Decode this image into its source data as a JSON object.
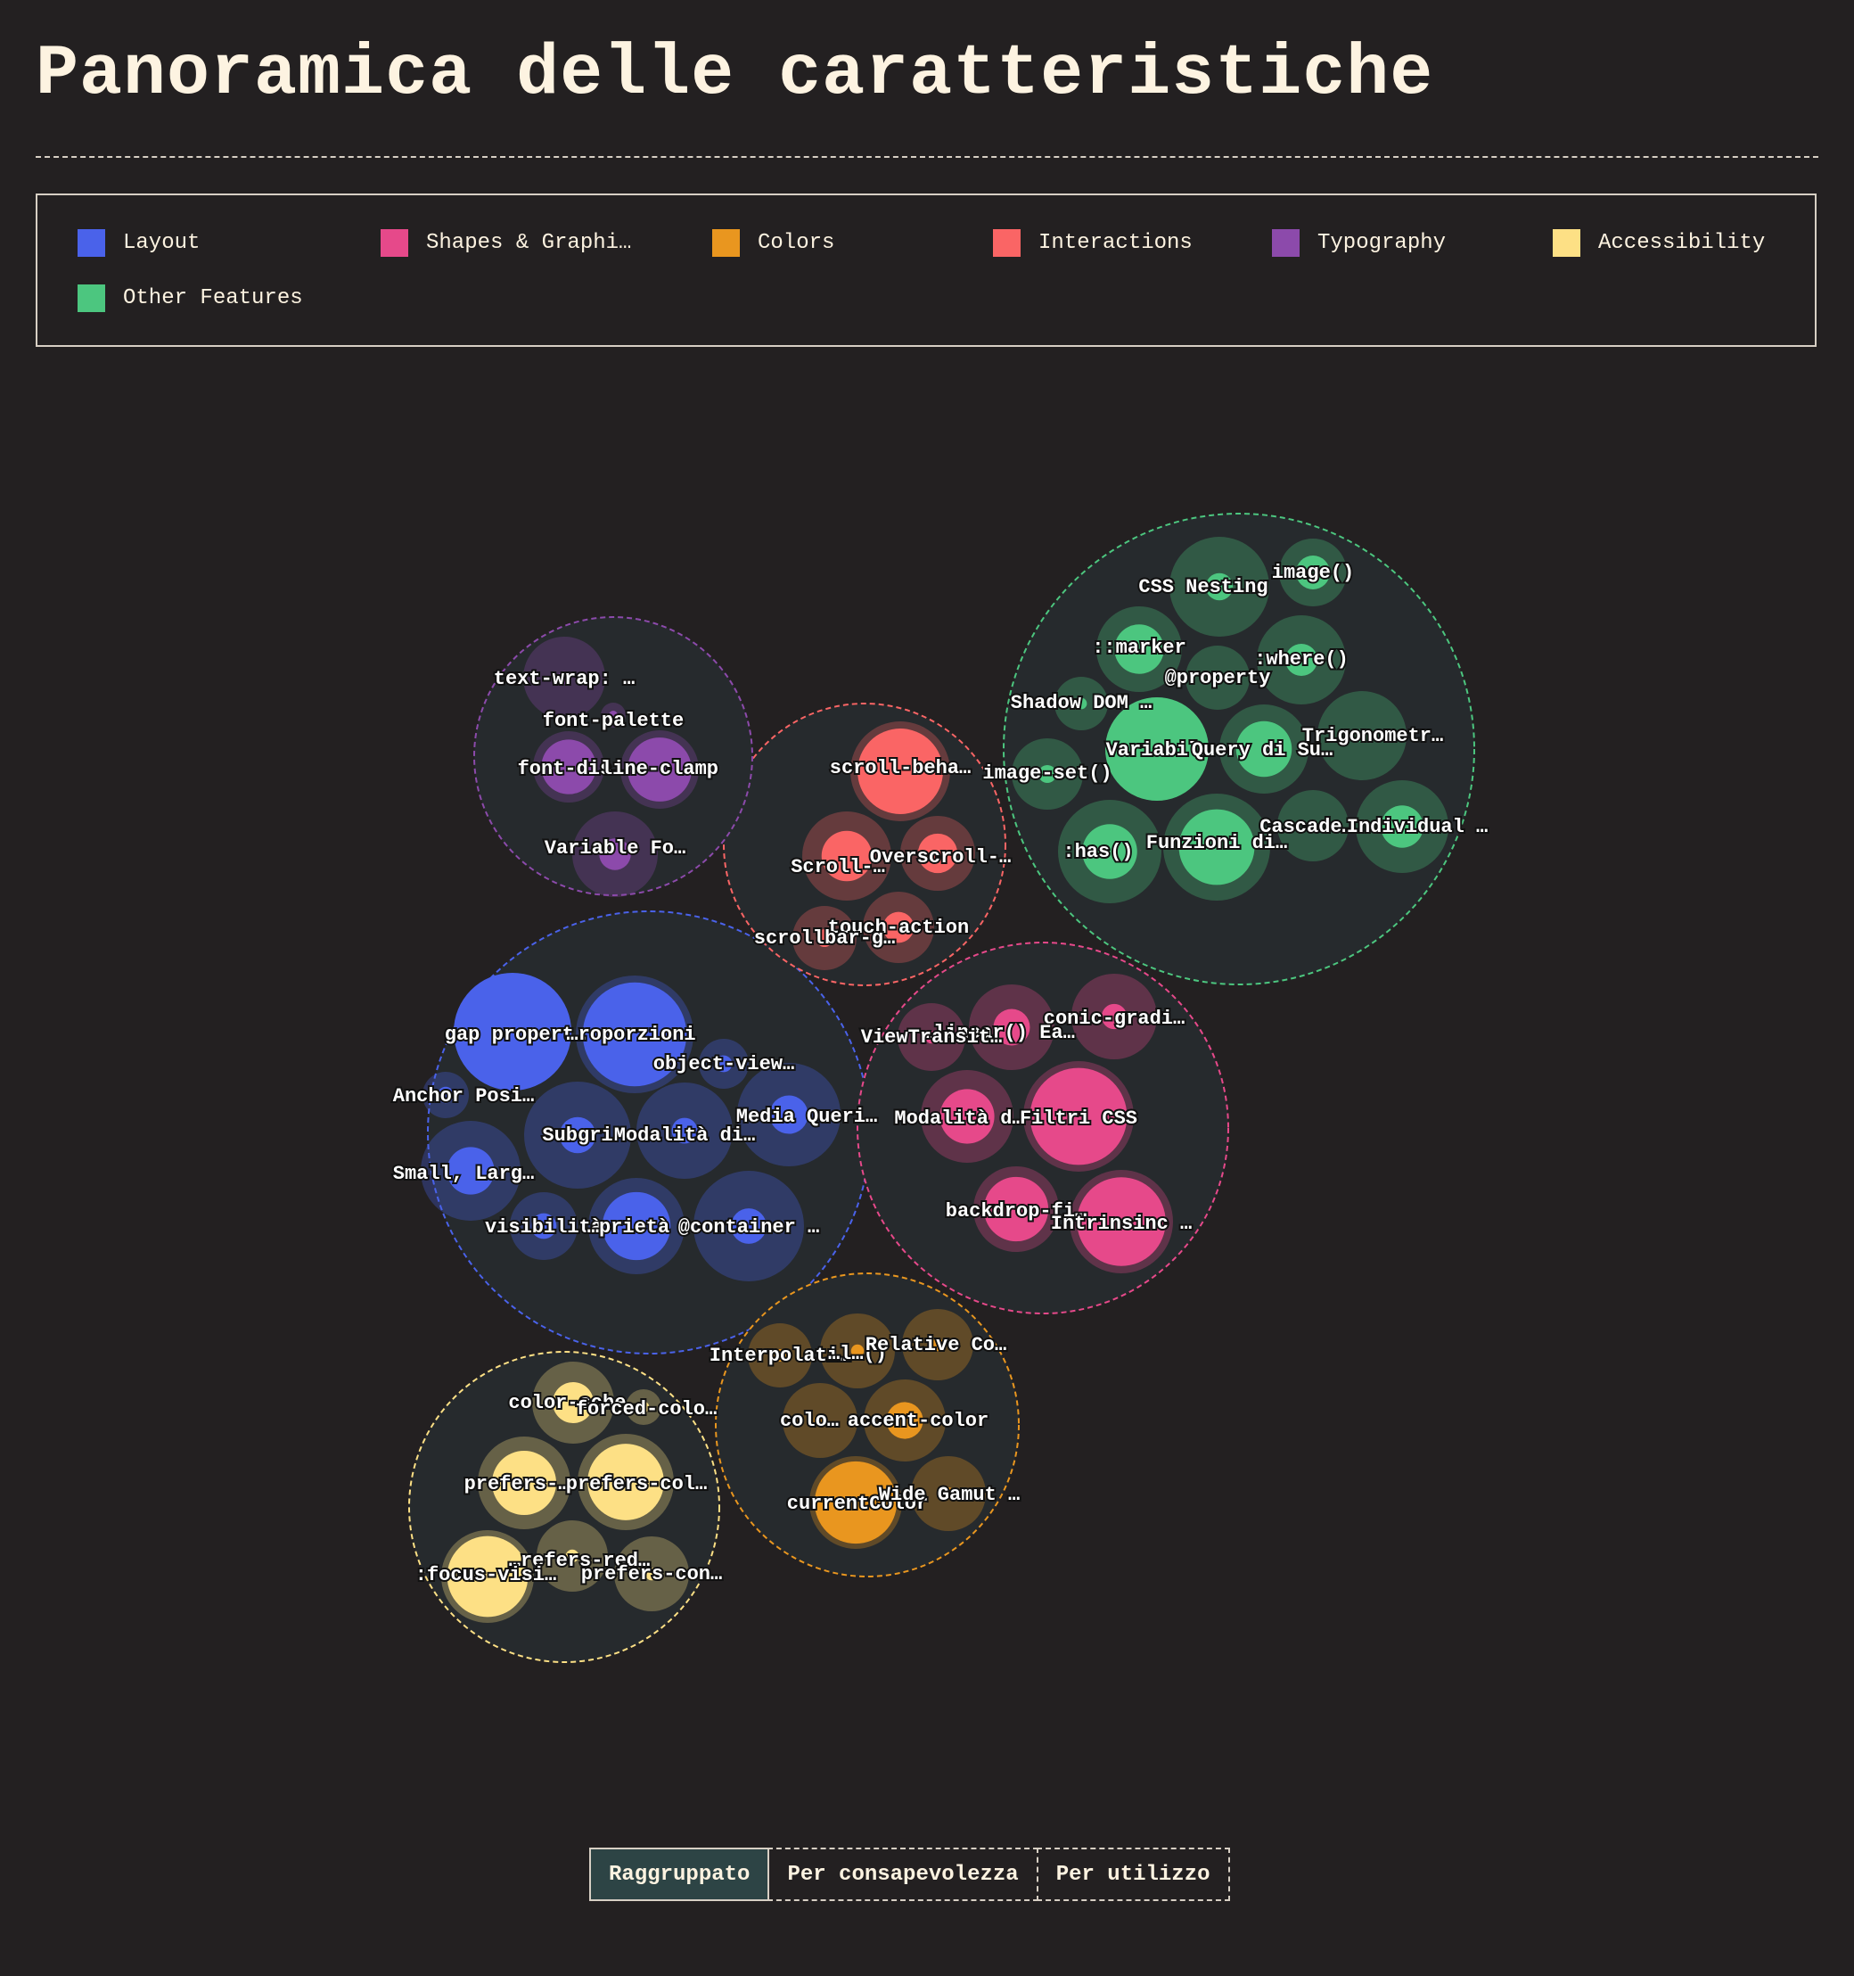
{
  "title": "Panoramica delle caratteristiche",
  "legend": [
    {
      "label": "Layout",
      "color": "#4a62ea"
    },
    {
      "label": "Shapes & Graphi…",
      "color": "#e6498a"
    },
    {
      "label": "Colors",
      "color": "#e9961f"
    },
    {
      "label": "Interactions",
      "color": "#fa6565"
    },
    {
      "label": "Typography",
      "color": "#8c4aab"
    },
    {
      "label": "Accessibility",
      "color": "#fde085"
    },
    {
      "label": "Other Features",
      "color": "#4cc67f"
    }
  ],
  "toggle": [
    {
      "label": "Raggruppato",
      "active": true
    },
    {
      "label": "Per consapevolezza",
      "active": false
    },
    {
      "label": "Per utilizzo",
      "active": false
    }
  ],
  "chart_data": {
    "type": "packed-bubble",
    "note_on_values": "size = relative awareness (outer), usage (inner), estimated 0-100",
    "groups": [
      {
        "name": "Layout",
        "color": "#4a62ea",
        "items": [
          {
            "label": "gap propert…",
            "outer": 90,
            "inner": 90
          },
          {
            "label": "…roporzioni",
            "outer": 90,
            "inner": 70
          },
          {
            "label": "object-view…",
            "outer": 18,
            "inner": 2
          },
          {
            "label": "Anchor Posi…",
            "outer": 16,
            "inner": 2
          },
          {
            "label": "Media Queri…",
            "outer": 58,
            "inner": 8
          },
          {
            "label": "Subgri",
            "outer": 70,
            "inner": 8
          },
          {
            "label": "Modalità di…",
            "outer": 56,
            "inner": 4
          },
          {
            "label": "Small, Larg…",
            "outer": 62,
            "inner": 14
          },
          {
            "label": "visibilità",
            "outer": 28,
            "inner": 4
          },
          {
            "label": "…prietà",
            "outer": 56,
            "inner": 28
          },
          {
            "label": "@container …",
            "outer": 78,
            "inner": 8
          }
        ]
      },
      {
        "name": "Shapes & Graphics",
        "color": "#e6498a",
        "items": [
          {
            "label": "conic-gradi…",
            "outer": 46,
            "inner": 4
          },
          {
            "label": "…linear() Ea…",
            "outer": 44,
            "inner": 8
          },
          {
            "label": "ViewTransit…",
            "outer": 28,
            "inner": 1
          },
          {
            "label": "Modalità d…",
            "outer": 52,
            "inner": 18
          },
          {
            "label": "Filtri CSS",
            "outer": 78,
            "inner": 60
          },
          {
            "label": "backdrop-fi…",
            "outer": 60,
            "inner": 34
          },
          {
            "label": "Intrinsinc …",
            "outer": 68,
            "inner": 50
          }
        ]
      },
      {
        "name": "Colors",
        "color": "#e9961f",
        "items": [
          {
            "label": "Interpolati…",
            "outer": 26,
            "inner": 1
          },
          {
            "label": "…l…()",
            "outer": 34,
            "inner": 1
          },
          {
            "label": "Relative Co…",
            "outer": 32,
            "inner": 1
          },
          {
            "label": "colo…",
            "outer": 34,
            "inner": 1
          },
          {
            "label": "accent-color",
            "outer": 40,
            "inner": 8
          },
          {
            "label": "currentColor",
            "outer": 56,
            "inner": 44
          },
          {
            "label": "Wide Gamut …",
            "outer": 36,
            "inner": 1
          }
        ]
      },
      {
        "name": "Interactions",
        "color": "#fa6565",
        "items": [
          {
            "label": "scroll-beha…",
            "outer": 60,
            "inner": 44
          },
          {
            "label": "Scroll-…",
            "outer": 50,
            "inner": 16
          },
          {
            "label": "Overscroll-…",
            "outer": 36,
            "inner": 10
          },
          {
            "label": "touch-action",
            "outer": 32,
            "inner": 6
          },
          {
            "label": "scrollbar-g…",
            "outer": 26,
            "inner": 2
          }
        ]
      },
      {
        "name": "Typography",
        "color": "#8c4aab",
        "items": [
          {
            "label": "text-wrap: …",
            "outer": 40,
            "inner": 1
          },
          {
            "label": "font-palette",
            "outer": 8,
            "inner": 1
          },
          {
            "label": "font-dis…",
            "outer": 34,
            "inner": 20
          },
          {
            "label": "line-clamp",
            "outer": 36,
            "inner": 24
          },
          {
            "label": "Variable Fo…",
            "outer": 44,
            "inner": 6
          }
        ]
      },
      {
        "name": "Accessibility",
        "color": "#fde085",
        "items": [
          {
            "label": "color-sche…",
            "outer": 40,
            "inner": 10
          },
          {
            "label": "forced-colo…",
            "outer": 10,
            "inner": 1
          },
          {
            "label": "prefers-…",
            "outer": 50,
            "inner": 24
          },
          {
            "label": "prefers-col…",
            "outer": 54,
            "inner": 34
          },
          {
            "label": "…refers-red…",
            "outer": 30,
            "inner": 1
          },
          {
            "label": ":focus-visi…",
            "outer": 50,
            "inner": 38
          },
          {
            "label": "prefers-con…",
            "outer": 34,
            "inner": 1
          }
        ]
      },
      {
        "name": "Other Features",
        "color": "#4cc67f",
        "items": [
          {
            "label": "CSS Nesting",
            "outer": 54,
            "inner": 4
          },
          {
            "label": "image()",
            "outer": 24,
            "inner": 6
          },
          {
            "label": "::marker",
            "outer": 42,
            "inner": 14
          },
          {
            "label": ":where()",
            "outer": 46,
            "inner": 6
          },
          {
            "label": "@property",
            "outer": 26,
            "inner": 1
          },
          {
            "label": "Shadow DOM …",
            "outer": 22,
            "inner": 1
          },
          {
            "label": "Variabil…",
            "outer": 62,
            "inner": 62
          },
          {
            "label": "Query di Su…",
            "outer": 46,
            "inner": 18
          },
          {
            "label": "Trigonometr…",
            "outer": 46,
            "inner": 1
          },
          {
            "label": "image-set()",
            "outer": 32,
            "inner": 2
          },
          {
            "label": ":has()",
            "outer": 64,
            "inner": 18
          },
          {
            "label": "Funzioni di…",
            "outer": 68,
            "inner": 34
          },
          {
            "label": "Cascade…",
            "outer": 34,
            "inner": 1
          },
          {
            "label": "Individual …",
            "outer": 48,
            "inner": 10
          }
        ]
      }
    ]
  }
}
